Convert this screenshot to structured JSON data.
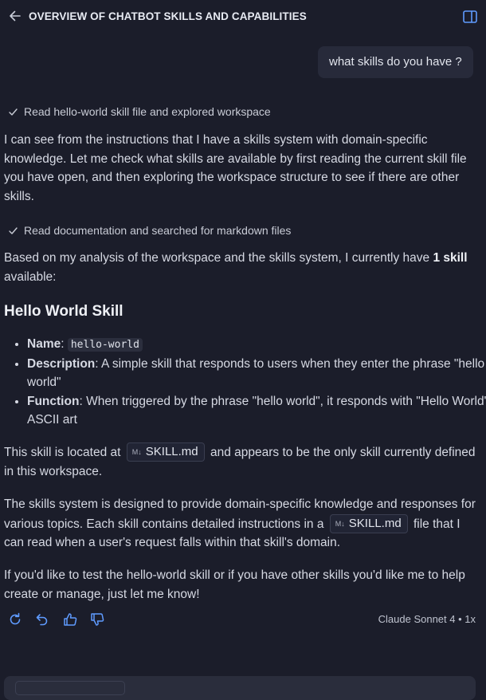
{
  "header": {
    "title": "OVERVIEW OF CHATBOT SKILLS AND CAPABILITIES",
    "icons": [
      "arrow-left-icon",
      "panel-icon"
    ]
  },
  "user_message": "what skills do you have ?",
  "steps": [
    "Read hello-world skill file and explored workspace",
    "Read documentation and searched for markdown files"
  ],
  "response": {
    "para1": "I can see from the instructions that I have a skills system with domain-specific knowledge. Let me check what skills are available by first reading the current skill file you have open, and then exploring the workspace structure to see if there are other skills.",
    "para2_a": "Based on my analysis of the workspace and the skills system, I currently have ",
    "para2_bold": "1 skill",
    "para2_b": " available:",
    "heading": "Hello World Skill",
    "items": [
      {
        "label": "Name",
        "sep": ": ",
        "code": "hello-world",
        "text": ""
      },
      {
        "label": "Description",
        "sep": ": ",
        "text": "A simple skill that responds to users when they enter the phrase \"hello world\""
      },
      {
        "label": "Function",
        "sep": ": ",
        "text": "When triggered by the phrase \"hello world\", it responds with \"Hello World\" in ASCII art"
      }
    ],
    "para3_a": "This skill is located at",
    "file_chip": "SKILL.md",
    "file_chip_icon": "M↓",
    "para3_b": "and appears to be the only skill currently defined in this workspace.",
    "para4_a": "The skills system is designed to provide domain-specific knowledge and responses for various topics. Each skill contains detailed instructions in a",
    "para4_b": "file that I can read when a user's request falls within that skill's domain.",
    "para5": "If you'd like to test the hello-world skill or if you have other skills you'd like me to help create or manage, just let me know!"
  },
  "footer": {
    "action_icons": [
      "retry-icon",
      "undo-icon",
      "thumbs-up-icon",
      "thumbs-down-icon"
    ],
    "model_label": "Claude Sonnet 4 • 1x"
  },
  "colors": {
    "background": "#1b1d2a",
    "bubble": "#272a3a",
    "text": "#d6d9e3"
  }
}
